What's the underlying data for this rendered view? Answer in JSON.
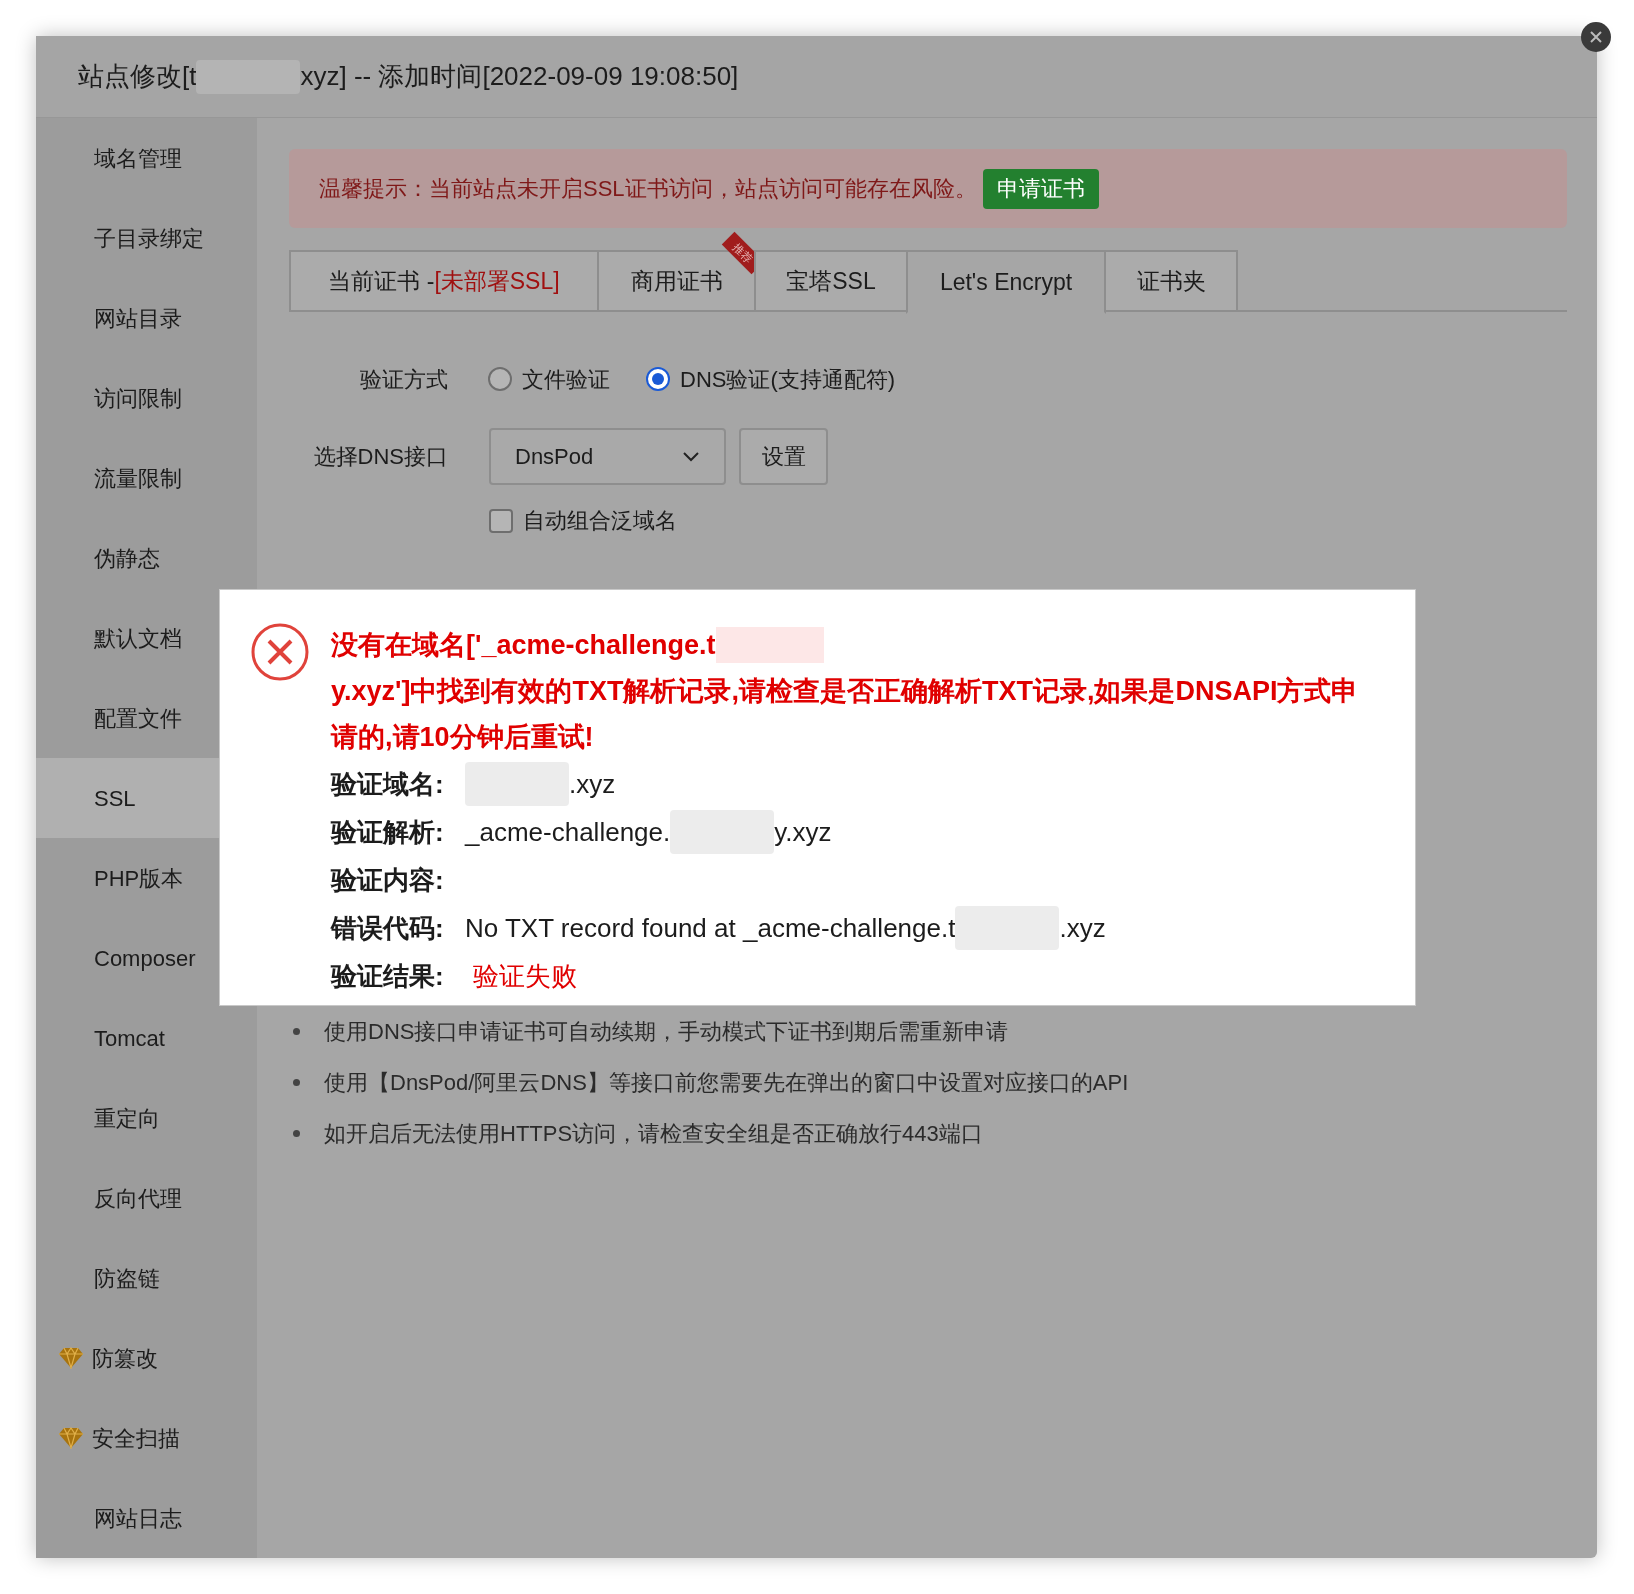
{
  "window": {
    "title_parts": [
      {
        "kind": "text",
        "text": "站点修改[t"
      },
      {
        "kind": "redaction"
      },
      {
        "kind": "text",
        "text": "xyz] -- 添加时间[2022-09-09 19:08:50]"
      }
    ]
  },
  "sidebar": {
    "items": [
      {
        "label": "域名管理",
        "selected": false,
        "kind": "plain"
      },
      {
        "label": "子目录绑定",
        "selected": false,
        "kind": "plain"
      },
      {
        "label": "网站目录",
        "selected": false,
        "kind": "plain"
      },
      {
        "label": "访问限制",
        "selected": false,
        "kind": "plain"
      },
      {
        "label": "流量限制",
        "selected": false,
        "kind": "plain"
      },
      {
        "label": "伪静态",
        "selected": false,
        "kind": "plain"
      },
      {
        "label": "默认文档",
        "selected": false,
        "kind": "plain"
      },
      {
        "label": "配置文件",
        "selected": false,
        "kind": "plain"
      },
      {
        "label": "SSL",
        "selected": true,
        "kind": "plain"
      },
      {
        "label": "PHP版本",
        "selected": false,
        "kind": "plain"
      },
      {
        "label": "Composer",
        "selected": false,
        "kind": "plain"
      },
      {
        "label": "Tomcat",
        "selected": false,
        "kind": "plain"
      },
      {
        "label": "重定向",
        "selected": false,
        "kind": "plain"
      },
      {
        "label": "反向代理",
        "selected": false,
        "kind": "plain"
      },
      {
        "label": "防盗链",
        "selected": false,
        "kind": "plain"
      },
      {
        "label": "防篡改",
        "selected": false,
        "kind": "premium"
      },
      {
        "label": "安全扫描",
        "selected": false,
        "kind": "premium"
      },
      {
        "label": "网站日志",
        "selected": false,
        "kind": "plain"
      }
    ]
  },
  "alert": {
    "text": "温馨提示：当前站点未开启SSL证书访问，站点访问可能存在风险。",
    "button": "申请证书"
  },
  "tabs": [
    {
      "label": "当前证书 - ",
      "note": "[未部署SSL]",
      "selected": false
    },
    {
      "label": "商用证书",
      "badge": "推荐",
      "selected": false
    },
    {
      "label": "宝塔SSL",
      "selected": false
    },
    {
      "label": "Let's Encrypt",
      "selected": true
    },
    {
      "label": "证书夹",
      "selected": false
    }
  ],
  "verify_method": {
    "label": "验证方式",
    "options": [
      {
        "label": "文件验证",
        "selected": false
      },
      {
        "label": "DNS验证(支持通配符)",
        "selected": true
      }
    ]
  },
  "dns": {
    "label": "选择DNS接口",
    "select": "DnsPod",
    "button": "设置"
  },
  "wildcard": {
    "label": "自动组合泛域名",
    "checked": false
  },
  "notes": [
    "使用DNS接口申请证书可自动续期，手动模式下证书到期后需重新申请",
    "使用【DnsPod/阿里云DNS】等接口前您需要先在弹出的窗口中设置对应接口的API",
    "如开启后无法使用HTTPS访问，请检查安全组是否正确放行443端口"
  ],
  "dialog": {
    "message_parts": [
      {
        "kind": "text",
        "text": "没有在域名['_acme-challenge.t"
      },
      {
        "kind": "redaction"
      },
      {
        "kind": "text",
        "text": "y.xyz']中找到有效的TXT解析记录,请检查是否正确解析TXT记录,如果是DNSAPI方式申请的,请10分钟后重试!"
      }
    ],
    "rows": [
      {
        "label": "验证域名:",
        "kind": "info",
        "parts": [
          {
            "kind": "redaction"
          },
          {
            "kind": "text",
            "text": ".xyz"
          }
        ]
      },
      {
        "label": "验证解析:",
        "kind": "info",
        "parts": [
          {
            "kind": "text",
            "text": "_acme-challenge."
          },
          {
            "kind": "redaction"
          },
          {
            "kind": "text",
            "text": "y.xyz"
          }
        ]
      },
      {
        "label": "验证内容:",
        "kind": "info",
        "parts": []
      },
      {
        "label": "错误代码:",
        "kind": "info",
        "parts": [
          {
            "kind": "text",
            "text": "No TXT record found at _acme-challenge.t"
          },
          {
            "kind": "redaction"
          },
          {
            "kind": "text",
            "text": ".xyz"
          }
        ]
      },
      {
        "label": "验证结果:",
        "kind": "failed",
        "parts": [
          {
            "kind": "text",
            "text": "验证失败"
          }
        ]
      }
    ]
  }
}
